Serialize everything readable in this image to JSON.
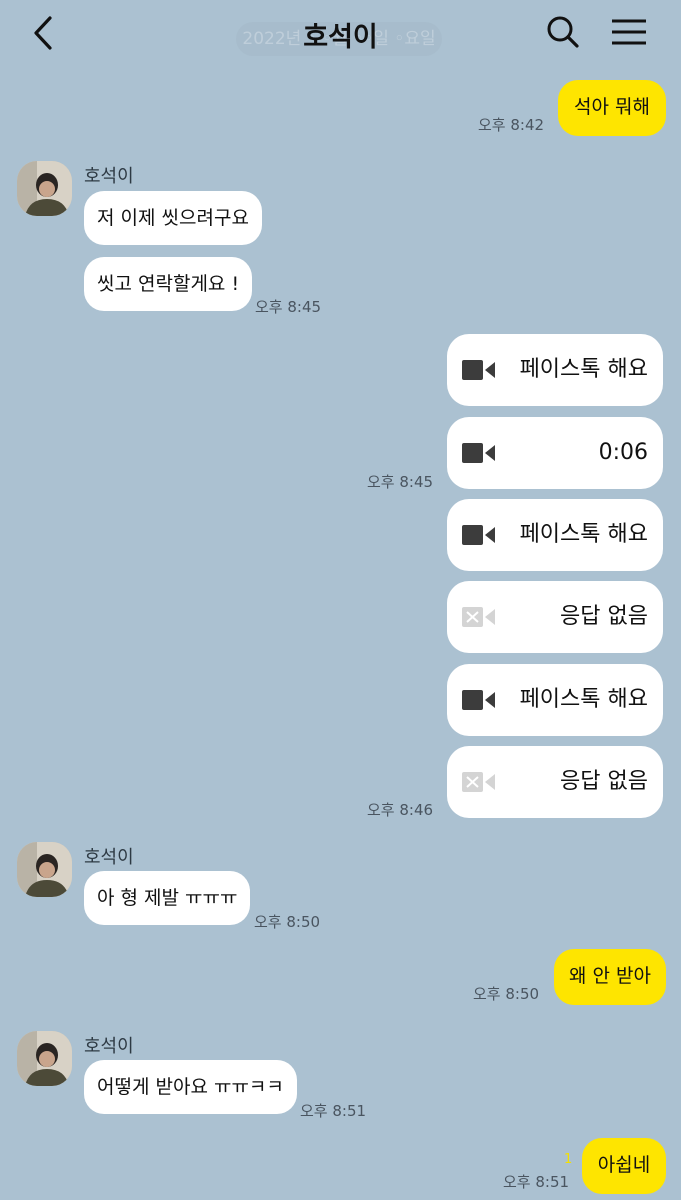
{
  "header": {
    "title": "호석이",
    "date_label": "2022년 ◦ ◦월 ◦◦일 ◦요일"
  },
  "messages": {
    "m1": {
      "text": "석아 뭐해",
      "time": "오후 8:42"
    },
    "s1": {
      "sender": "호석이"
    },
    "m2": {
      "text": "저 이제 씻으려구요"
    },
    "m3": {
      "text": "씻고 연락할게요 !",
      "time": "오후 8:45"
    },
    "calls": [
      {
        "label": "페이스톡 해요",
        "icon": "video-camera-icon"
      },
      {
        "label": "0:06",
        "icon": "video-camera-icon"
      },
      {
        "label": "페이스톡 해요",
        "icon": "video-camera-icon"
      },
      {
        "label": "응답 없음",
        "icon": "missed-video-icon"
      },
      {
        "label": "페이스톡 해요",
        "icon": "video-camera-icon"
      },
      {
        "label": "응답 없음",
        "icon": "missed-video-icon"
      }
    ],
    "calls_time_1": "오후 8:45",
    "calls_time_2": "오후 8:46",
    "s2": {
      "sender": "호석이"
    },
    "m4": {
      "text": "아 형 제발 ㅠㅠㅠ",
      "time": "오후 8:50"
    },
    "m5": {
      "text": "왜 안 받아",
      "time": "오후 8:50"
    },
    "s3": {
      "sender": "호석이"
    },
    "m6": {
      "text": "어떻게 받아요 ㅠㅠㅋㅋ",
      "time": "오후 8:51"
    },
    "m7": {
      "text": "아쉽네",
      "time": "오후 8:51",
      "unread": "1"
    }
  },
  "colors": {
    "background": "#abc1d1",
    "my_bubble": "#fee500",
    "their_bubble": "#ffffff"
  }
}
